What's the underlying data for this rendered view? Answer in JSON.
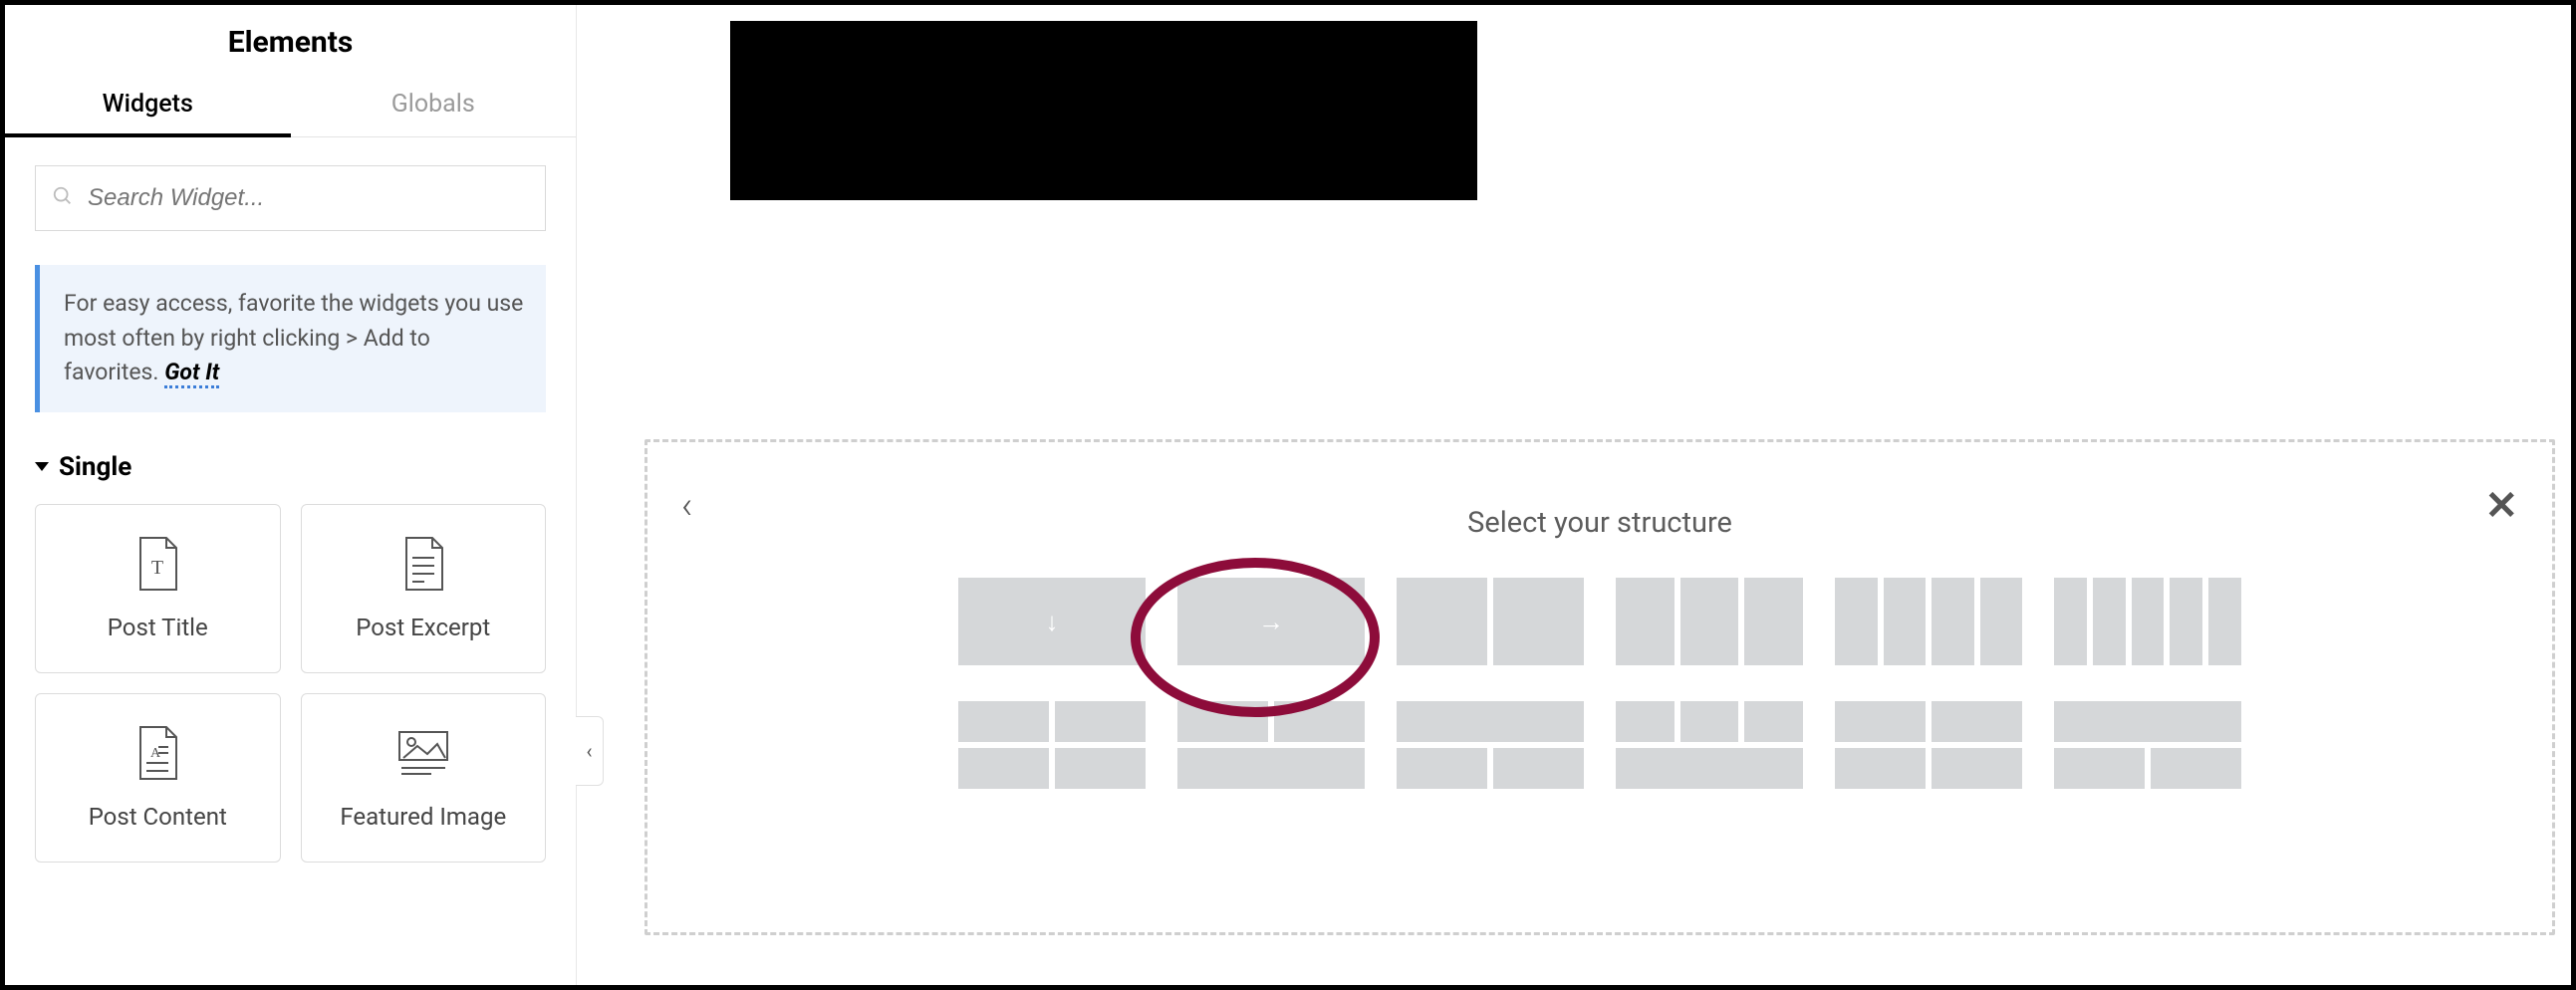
{
  "sidebar": {
    "title": "Elements",
    "tabs": {
      "widgets": "Widgets",
      "globals": "Globals"
    },
    "search_placeholder": "Search Widget...",
    "tip_text": "For easy access, favorite the widgets you use most often by right clicking > Add to favorites.",
    "tip_got_it": "Got It",
    "section_label": "Single",
    "widgets": {
      "post_title": "Post Title",
      "post_excerpt": "Post Excerpt",
      "post_content": "Post Content",
      "featured_image": "Featured Image"
    }
  },
  "structure": {
    "title": "Select your structure"
  }
}
